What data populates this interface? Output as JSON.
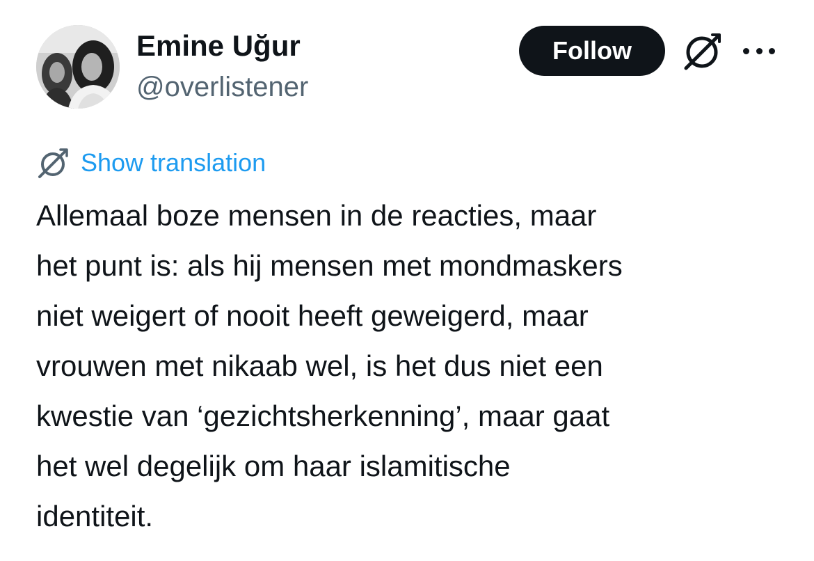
{
  "author": {
    "display_name": "Emine Uğur",
    "handle": "@overlistener",
    "avatar_icon": "profile-photo"
  },
  "actions": {
    "follow_label": "Follow",
    "grok_icon": "grok-icon",
    "more_icon": "more-options-icon"
  },
  "translation": {
    "icon": "translate-icon",
    "link_label": "Show translation"
  },
  "tweet": {
    "text": "Allemaal boze mensen in de reacties, maar\nhet punt is: als hij mensen met mondmaskers\nniet weigert of nooit heeft geweigerd, maar\nvrouwen met nikaab wel, is het dus niet een\nkwestie van ‘gezichtsherkenning’, maar gaat\nhet wel degelijk om haar islamitische\nidentiteit."
  },
  "colors": {
    "text": "#0f1419",
    "secondary": "#536471",
    "link": "#1d9bf0",
    "button_bg": "#0f1419",
    "button_text": "#ffffff"
  }
}
